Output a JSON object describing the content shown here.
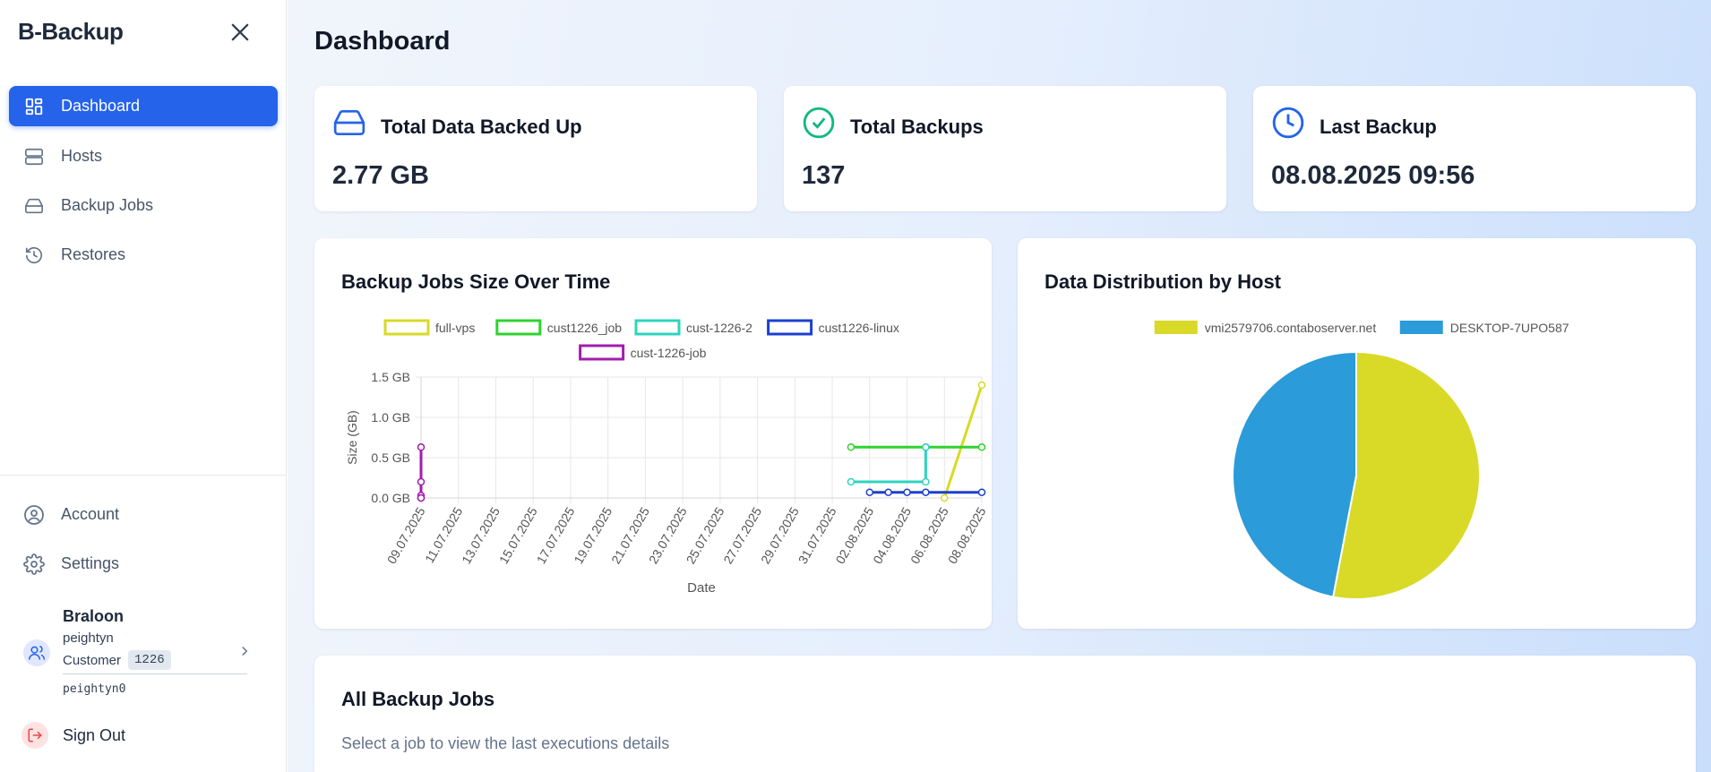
{
  "app": {
    "brand": "B-Backup"
  },
  "sidebar": {
    "nav": [
      {
        "label": "Dashboard",
        "icon": "dashboard-icon",
        "active": true
      },
      {
        "label": "Hosts",
        "icon": "server-icon"
      },
      {
        "label": "Backup Jobs",
        "icon": "hard-drive-icon"
      },
      {
        "label": "Restores",
        "icon": "history-icon"
      }
    ],
    "bottom": [
      {
        "label": "Account",
        "icon": "user-circle-icon"
      },
      {
        "label": "Settings",
        "icon": "gear-icon"
      }
    ],
    "user": {
      "name": "Braloon",
      "login": "peightyn",
      "role": "Customer",
      "role_id": "1226",
      "code": "peightyn0"
    },
    "signout": "Sign Out"
  },
  "page": {
    "title": "Dashboard"
  },
  "stats": [
    {
      "title": "Total Data Backed Up",
      "value": "2.77 GB",
      "icon": "hard-drive-icon"
    },
    {
      "title": "Total Backups",
      "value": "137",
      "icon": "check-circle-icon"
    },
    {
      "title": "Last Backup",
      "value": "08.08.2025 09:56",
      "icon": "clock-icon"
    }
  ],
  "line_card": {
    "title": "Backup Jobs Size Over Time"
  },
  "pie_card": {
    "title": "Data Distribution by Host"
  },
  "jobs_card": {
    "title": "All Backup Jobs",
    "subtitle": "Select a job to view the last executions details"
  },
  "colors": {
    "accent": "#2563eb",
    "full_vps": "#d9d927",
    "cust1226_job": "#2fd22f",
    "cust_1226_2": "#2dd4bf",
    "cust1226_linux": "#1d3fd0",
    "cust_1226_job": "#a21caf",
    "host1": "#d9d927",
    "host2": "#2b9bd9"
  },
  "chart_data": [
    {
      "type": "line",
      "title": "Backup Jobs Size Over Time",
      "xlabel": "Date",
      "ylabel": "Size (GB)",
      "x_categories": [
        "09.07.2025",
        "11.07.2025",
        "13.07.2025",
        "15.07.2025",
        "17.07.2025",
        "19.07.2025",
        "21.07.2025",
        "23.07.2025",
        "25.07.2025",
        "27.07.2025",
        "29.07.2025",
        "31.07.2025",
        "02.08.2025",
        "04.08.2025",
        "06.08.2025",
        "08.08.2025"
      ],
      "x_range": [
        "09.07.2025",
        "08.08.2025"
      ],
      "y_ticks": [
        "0.0 GB",
        "0.5 GB",
        "1.0 GB",
        "1.5 GB"
      ],
      "ylim": [
        0,
        1.5
      ],
      "grid": true,
      "legend": "top",
      "series": [
        {
          "name": "full-vps",
          "color": "#d9d927",
          "points": [
            {
              "x": "06.08.2025",
              "y": 0.0
            },
            {
              "x": "08.08.2025",
              "y": 1.4
            }
          ]
        },
        {
          "name": "cust1226_job",
          "color": "#2fd22f",
          "points": [
            {
              "x": "01.08.2025",
              "y": 0.63
            },
            {
              "x": "05.08.2025",
              "y": 0.63
            },
            {
              "x": "08.08.2025",
              "y": 0.63
            }
          ]
        },
        {
          "name": "cust-1226-2",
          "color": "#2dd4bf",
          "points": [
            {
              "x": "01.08.2025",
              "y": 0.2
            },
            {
              "x": "05.08.2025",
              "y": 0.2
            },
            {
              "x": "05.08.2025",
              "y": 0.63
            }
          ]
        },
        {
          "name": "cust1226-linux",
          "color": "#1d3fd0",
          "points": [
            {
              "x": "02.08.2025",
              "y": 0.07
            },
            {
              "x": "03.08.2025",
              "y": 0.07
            },
            {
              "x": "04.08.2025",
              "y": 0.07
            },
            {
              "x": "05.08.2025",
              "y": 0.07
            },
            {
              "x": "08.08.2025",
              "y": 0.07
            }
          ]
        },
        {
          "name": "cust-1226-job",
          "color": "#a21caf",
          "points": [
            {
              "x": "09.07.2025",
              "y": 0.03
            },
            {
              "x": "09.07.2025",
              "y": 0.0
            },
            {
              "x": "09.07.2025",
              "y": 0.0
            },
            {
              "x": "09.07.2025",
              "y": 0.2
            },
            {
              "x": "09.07.2025",
              "y": 0.63
            }
          ]
        }
      ]
    },
    {
      "type": "pie",
      "title": "Data Distribution by Host",
      "legend": "top",
      "slices": [
        {
          "label": "vmi2579706.contaboserver.net",
          "value": 53,
          "color": "#d9d927"
        },
        {
          "label": "DESKTOP-7UPO587",
          "value": 47,
          "color": "#2b9bd9"
        }
      ]
    }
  ]
}
